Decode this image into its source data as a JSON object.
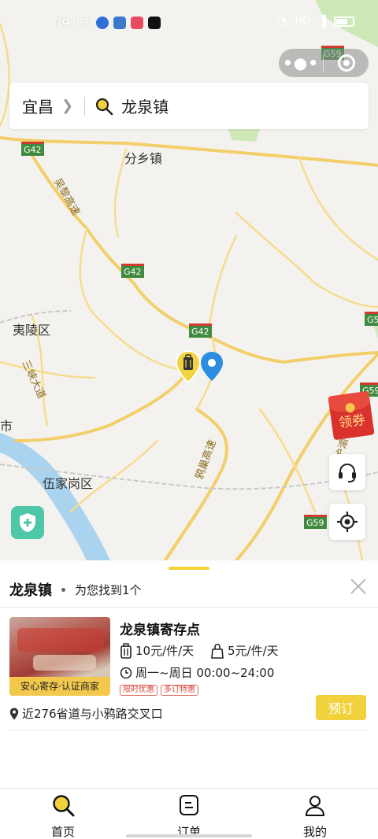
{
  "status_bar": {
    "time": "09:18",
    "network": "HD"
  },
  "search": {
    "city": "宜昌",
    "query": "龙泉镇"
  },
  "map": {
    "places": [
      {
        "id": "fenxiang",
        "label": "分乡镇"
      },
      {
        "id": "yiling",
        "label": "夷陵区"
      },
      {
        "id": "wujiagang",
        "label": "伍家岗区"
      },
      {
        "id": "shi",
        "label": "市"
      }
    ],
    "road_labels": [
      {
        "id": "wuyi",
        "label": "吴黎高速"
      },
      {
        "id": "sanxia",
        "label": "三峡大道"
      },
      {
        "id": "yuqi",
        "label": "鸦巢高速"
      },
      {
        "id": "huyu",
        "label": "沪渝"
      }
    ],
    "highway_shields": [
      {
        "id": "g59-top",
        "label": "G59"
      },
      {
        "id": "g42-a",
        "label": "G42"
      },
      {
        "id": "g42-b",
        "label": "G42"
      },
      {
        "id": "g42-c",
        "label": "G42"
      },
      {
        "id": "g59-r1",
        "label": "G5"
      },
      {
        "id": "g59-r2",
        "label": "G59"
      },
      {
        "id": "g59-bot",
        "label": "G59"
      },
      {
        "id": "g59-r3",
        "label": "G59"
      }
    ],
    "coupon_label": "领券"
  },
  "result": {
    "location": "龙泉镇",
    "found_text": "为您找到1个",
    "store": {
      "name": "龙泉镇寄存点",
      "price_large": "10元/件/天",
      "price_small": "5元/件/天",
      "hours": "周一~周日 00:00~24:00",
      "badges": [
        "限时优惠",
        "多订特惠"
      ],
      "thumb_tag": "安心寄存·认证商家",
      "book_label": "预订",
      "address": "近276省道与小鸦路交叉口"
    }
  },
  "tabs": [
    {
      "label": "首页",
      "icon": "search-icon"
    },
    {
      "label": "订单",
      "icon": "order-icon"
    },
    {
      "label": "我的",
      "icon": "profile-icon"
    }
  ],
  "colors": {
    "accent": "#f1d13c",
    "road_yellow": "#f5d77a",
    "river": "#a9d3ef",
    "coupon_red": "#d9322c"
  }
}
